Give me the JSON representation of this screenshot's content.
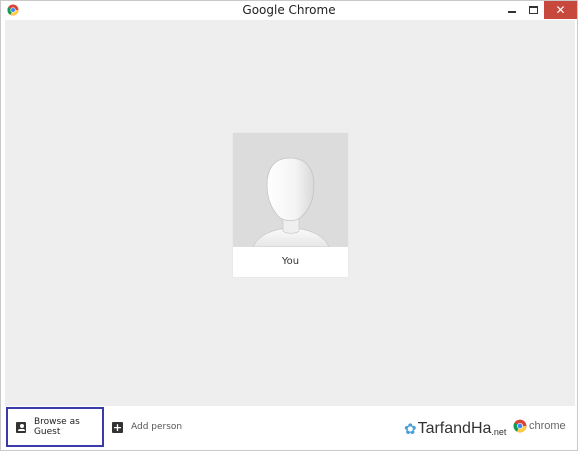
{
  "window": {
    "title": "Google Chrome",
    "close_glyph": "✕"
  },
  "profile": {
    "name": "You"
  },
  "bottom_bar": {
    "guest_label": "Browse as Guest",
    "add_person_label": "Add person",
    "add_glyph": "+",
    "watermark_main": "TarfandHa",
    "watermark_suffix": ".net",
    "brand_label": "chrome"
  },
  "colors": {
    "close_button": "#c7483d",
    "guest_highlight_border": "#3a3aa8",
    "content_background": "#eeeeee"
  },
  "icons": [
    "chrome-icon",
    "minimize-icon",
    "maximize-icon",
    "close-icon",
    "avatar-silhouette-icon",
    "guest-icon",
    "add-person-icon",
    "tarfandha-logo-icon",
    "chrome-logo-icon"
  ]
}
